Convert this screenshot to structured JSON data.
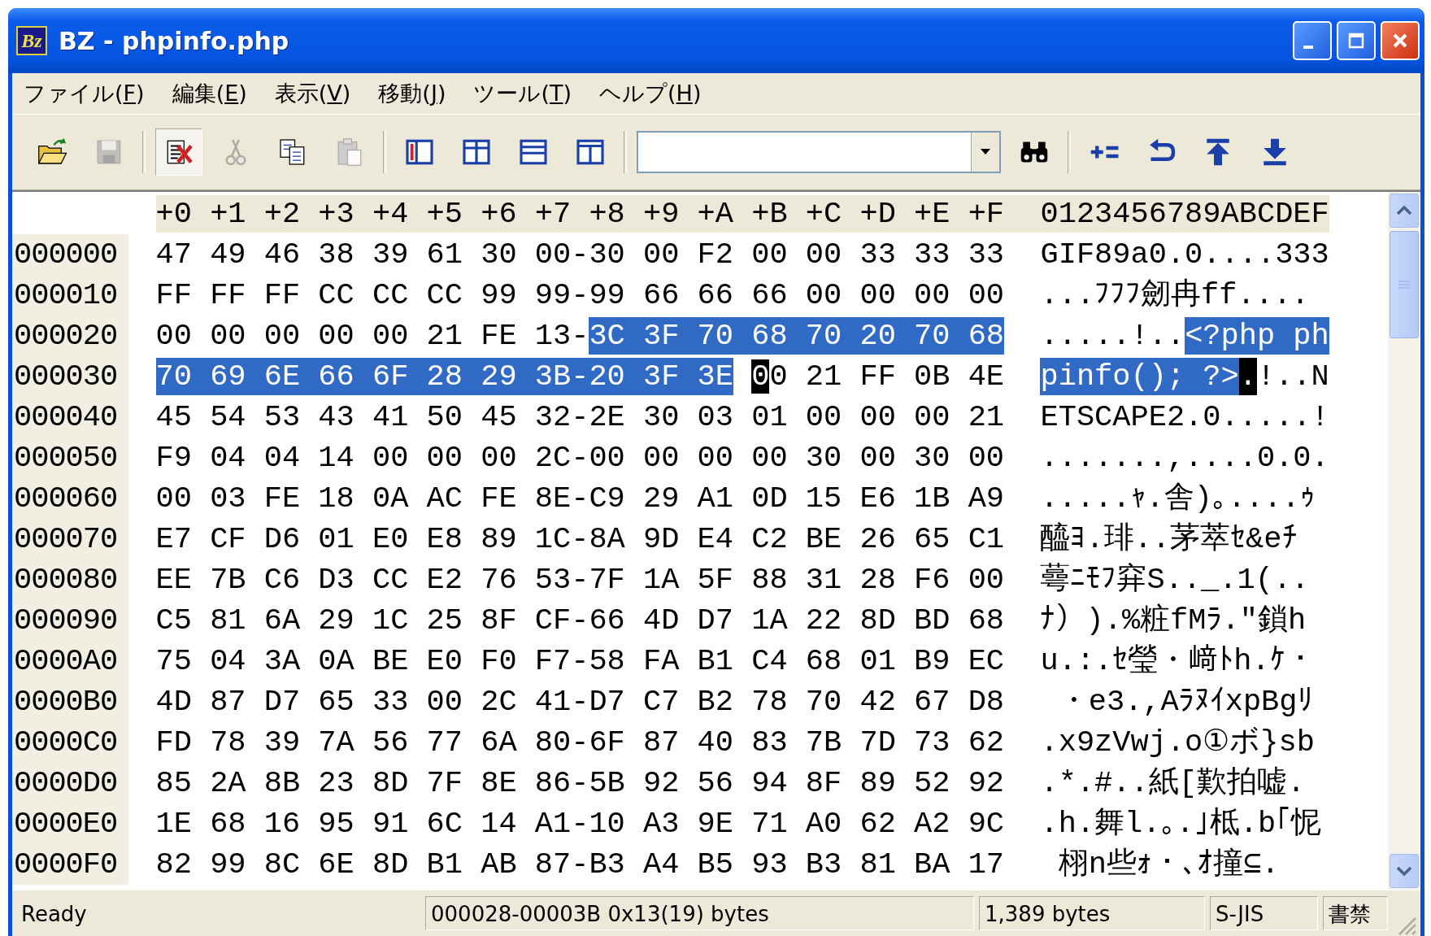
{
  "window": {
    "title": "BZ - phpinfo.php",
    "app_icon_text": "Bz"
  },
  "menu": [
    {
      "before": "ファイル(",
      "accel": "F",
      "after": ")"
    },
    {
      "before": "編集(",
      "accel": "E",
      "after": ")"
    },
    {
      "before": "表示(",
      "accel": "V",
      "after": ")"
    },
    {
      "before": "移動(",
      "accel": "J",
      "after": ")"
    },
    {
      "before": "ツール(",
      "accel": "T",
      "after": ")"
    },
    {
      "before": "ヘルプ(",
      "accel": "H",
      "after": ")"
    }
  ],
  "toolbar": [
    {
      "kind": "open",
      "disabled": false,
      "checked": false
    },
    {
      "kind": "save",
      "disabled": true,
      "checked": false
    },
    {
      "kind": "separator"
    },
    {
      "kind": "edit",
      "disabled": false,
      "checked": true
    },
    {
      "kind": "cut",
      "disabled": true,
      "checked": false
    },
    {
      "kind": "copy",
      "disabled": false,
      "checked": false
    },
    {
      "kind": "paste",
      "disabled": true,
      "checked": false
    },
    {
      "kind": "separator"
    },
    {
      "kind": "view-a",
      "disabled": false,
      "checked": false
    },
    {
      "kind": "view-b",
      "disabled": false,
      "checked": false
    },
    {
      "kind": "view-c",
      "disabled": false,
      "checked": false
    },
    {
      "kind": "view-d",
      "disabled": false,
      "checked": false
    },
    {
      "kind": "separator"
    },
    {
      "kind": "combo"
    },
    {
      "kind": "find",
      "disabled": false,
      "checked": false
    },
    {
      "kind": "separator"
    },
    {
      "kind": "calc",
      "disabled": false,
      "checked": false
    },
    {
      "kind": "back",
      "disabled": false,
      "checked": false
    },
    {
      "kind": "top",
      "disabled": false,
      "checked": false
    },
    {
      "kind": "bottom",
      "disabled": false,
      "checked": false
    }
  ],
  "hex": {
    "columns": [
      "+0",
      "+1",
      "+2",
      "+3",
      "+4",
      "+5",
      "+6",
      "+7",
      "+8",
      "+9",
      "+A",
      "+B",
      "+C",
      "+D",
      "+E",
      "+F"
    ],
    "ascii_header": "0123456789ABCDEF",
    "rows": [
      {
        "address": "000000",
        "separator": "-",
        "bytes": [
          {
            "value": "47",
            "kind": "plain"
          },
          {
            "value": "49",
            "kind": "plain"
          },
          {
            "value": "46",
            "kind": "plain"
          },
          {
            "value": "38",
            "kind": "plain"
          },
          {
            "value": "39",
            "kind": "plain"
          },
          {
            "value": "61",
            "kind": "plain"
          },
          {
            "value": "30",
            "kind": "plain"
          },
          {
            "value": "00",
            "kind": "plain"
          },
          {
            "value": "30",
            "kind": "plain"
          },
          {
            "value": "00",
            "kind": "plain"
          },
          {
            "value": "F2",
            "kind": "plain"
          },
          {
            "value": "00",
            "kind": "plain"
          },
          {
            "value": "00",
            "kind": "plain"
          },
          {
            "value": "33",
            "kind": "plain"
          },
          {
            "value": "33",
            "kind": "plain"
          },
          {
            "value": "33",
            "kind": "plain"
          }
        ],
        "ascii": [
          {
            "text": "GIF89a0.0....333",
            "kind": "plain"
          }
        ]
      },
      {
        "address": "000010",
        "separator": "-",
        "bytes": [
          {
            "value": "FF",
            "kind": "plain"
          },
          {
            "value": "FF",
            "kind": "plain"
          },
          {
            "value": "FF",
            "kind": "plain"
          },
          {
            "value": "CC",
            "kind": "plain"
          },
          {
            "value": "CC",
            "kind": "plain"
          },
          {
            "value": "CC",
            "kind": "plain"
          },
          {
            "value": "99",
            "kind": "plain"
          },
          {
            "value": "99",
            "kind": "plain"
          },
          {
            "value": "99",
            "kind": "plain"
          },
          {
            "value": "66",
            "kind": "plain"
          },
          {
            "value": "66",
            "kind": "plain"
          },
          {
            "value": "66",
            "kind": "plain"
          },
          {
            "value": "00",
            "kind": "plain"
          },
          {
            "value": "00",
            "kind": "plain"
          },
          {
            "value": "00",
            "kind": "plain"
          },
          {
            "value": "00",
            "kind": "plain"
          }
        ],
        "ascii": [
          {
            "text": "...ﾌﾌﾌ劒冉ff....",
            "kind": "plain"
          }
        ]
      },
      {
        "address": "000020",
        "separator": "-",
        "bytes": [
          {
            "value": "00",
            "kind": "plain"
          },
          {
            "value": "00",
            "kind": "plain"
          },
          {
            "value": "00",
            "kind": "plain"
          },
          {
            "value": "00",
            "kind": "plain"
          },
          {
            "value": "00",
            "kind": "plain"
          },
          {
            "value": "21",
            "kind": "plain"
          },
          {
            "value": "FE",
            "kind": "plain"
          },
          {
            "value": "13",
            "kind": "plain"
          },
          {
            "value": "3C",
            "kind": "selected"
          },
          {
            "value": "3F",
            "kind": "selected"
          },
          {
            "value": "70",
            "kind": "selected"
          },
          {
            "value": "68",
            "kind": "selected"
          },
          {
            "value": "70",
            "kind": "selected"
          },
          {
            "value": "20",
            "kind": "selected"
          },
          {
            "value": "70",
            "kind": "selected"
          },
          {
            "value": "68",
            "kind": "selected"
          }
        ],
        "ascii": [
          {
            "text": ".....!..",
            "kind": "plain"
          },
          {
            "text": "<?php ph",
            "kind": "selected"
          }
        ]
      },
      {
        "address": "000030",
        "separator": "-",
        "bytes": [
          {
            "value": "70",
            "kind": "selected"
          },
          {
            "value": "69",
            "kind": "selected"
          },
          {
            "value": "6E",
            "kind": "selected"
          },
          {
            "value": "66",
            "kind": "selected"
          },
          {
            "value": "6F",
            "kind": "selected"
          },
          {
            "value": "28",
            "kind": "selected"
          },
          {
            "value": "29",
            "kind": "selected"
          },
          {
            "value": "3B",
            "kind": "selected"
          },
          {
            "value": "20",
            "kind": "selected"
          },
          {
            "value": "3F",
            "kind": "selected"
          },
          {
            "value": "3E",
            "kind": "selected"
          },
          {
            "value": "00",
            "kind": "cursor"
          },
          {
            "value": "21",
            "kind": "plain"
          },
          {
            "value": "FF",
            "kind": "plain"
          },
          {
            "value": "0B",
            "kind": "plain"
          },
          {
            "value": "4E",
            "kind": "plain"
          }
        ],
        "ascii": [
          {
            "text": "pinfo(); ?>",
            "kind": "selected"
          },
          {
            "text": ".",
            "kind": "cursor"
          },
          {
            "text": "!..N",
            "kind": "plain"
          }
        ]
      },
      {
        "address": "000040",
        "separator": "-",
        "bytes": [
          {
            "value": "45",
            "kind": "plain"
          },
          {
            "value": "54",
            "kind": "plain"
          },
          {
            "value": "53",
            "kind": "plain"
          },
          {
            "value": "43",
            "kind": "plain"
          },
          {
            "value": "41",
            "kind": "plain"
          },
          {
            "value": "50",
            "kind": "plain"
          },
          {
            "value": "45",
            "kind": "plain"
          },
          {
            "value": "32",
            "kind": "plain"
          },
          {
            "value": "2E",
            "kind": "plain"
          },
          {
            "value": "30",
            "kind": "plain"
          },
          {
            "value": "03",
            "kind": "plain"
          },
          {
            "value": "01",
            "kind": "plain"
          },
          {
            "value": "00",
            "kind": "plain"
          },
          {
            "value": "00",
            "kind": "plain"
          },
          {
            "value": "00",
            "kind": "plain"
          },
          {
            "value": "21",
            "kind": "plain"
          }
        ],
        "ascii": [
          {
            "text": "ETSCAPE2.0.....!",
            "kind": "plain"
          }
        ]
      },
      {
        "address": "000050",
        "separator": "-",
        "bytes": [
          {
            "value": "F9",
            "kind": "plain"
          },
          {
            "value": "04",
            "kind": "plain"
          },
          {
            "value": "04",
            "kind": "plain"
          },
          {
            "value": "14",
            "kind": "plain"
          },
          {
            "value": "00",
            "kind": "plain"
          },
          {
            "value": "00",
            "kind": "plain"
          },
          {
            "value": "00",
            "kind": "plain"
          },
          {
            "value": "2C",
            "kind": "plain"
          },
          {
            "value": "00",
            "kind": "plain"
          },
          {
            "value": "00",
            "kind": "plain"
          },
          {
            "value": "00",
            "kind": "plain"
          },
          {
            "value": "00",
            "kind": "plain"
          },
          {
            "value": "30",
            "kind": "plain"
          },
          {
            "value": "00",
            "kind": "plain"
          },
          {
            "value": "30",
            "kind": "plain"
          },
          {
            "value": "00",
            "kind": "plain"
          }
        ],
        "ascii": [
          {
            "text": ".......,....0.0.",
            "kind": "plain"
          }
        ]
      },
      {
        "address": "000060",
        "separator": "-",
        "bytes": [
          {
            "value": "00",
            "kind": "plain"
          },
          {
            "value": "03",
            "kind": "plain"
          },
          {
            "value": "FE",
            "kind": "plain"
          },
          {
            "value": "18",
            "kind": "plain"
          },
          {
            "value": "0A",
            "kind": "plain"
          },
          {
            "value": "AC",
            "kind": "plain"
          },
          {
            "value": "FE",
            "kind": "plain"
          },
          {
            "value": "8E",
            "kind": "plain"
          },
          {
            "value": "C9",
            "kind": "plain"
          },
          {
            "value": "29",
            "kind": "plain"
          },
          {
            "value": "A1",
            "kind": "plain"
          },
          {
            "value": "0D",
            "kind": "plain"
          },
          {
            "value": "15",
            "kind": "plain"
          },
          {
            "value": "E6",
            "kind": "plain"
          },
          {
            "value": "1B",
            "kind": "plain"
          },
          {
            "value": "A9",
            "kind": "plain"
          }
        ],
        "ascii": [
          {
            "text": ".....ｬ.舎)｡....ｩ",
            "kind": "plain"
          }
        ]
      },
      {
        "address": "000070",
        "separator": "-",
        "bytes": [
          {
            "value": "E7",
            "kind": "plain"
          },
          {
            "value": "CF",
            "kind": "plain"
          },
          {
            "value": "D6",
            "kind": "plain"
          },
          {
            "value": "01",
            "kind": "plain"
          },
          {
            "value": "E0",
            "kind": "plain"
          },
          {
            "value": "E8",
            "kind": "plain"
          },
          {
            "value": "89",
            "kind": "plain"
          },
          {
            "value": "1C",
            "kind": "plain"
          },
          {
            "value": "8A",
            "kind": "plain"
          },
          {
            "value": "9D",
            "kind": "plain"
          },
          {
            "value": "E4",
            "kind": "plain"
          },
          {
            "value": "C2",
            "kind": "plain"
          },
          {
            "value": "BE",
            "kind": "plain"
          },
          {
            "value": "26",
            "kind": "plain"
          },
          {
            "value": "65",
            "kind": "plain"
          },
          {
            "value": "C1",
            "kind": "plain"
          }
        ],
        "ascii": [
          {
            "text": "醯ﾖ.琲..茅萃ｾ&eﾁ",
            "kind": "plain"
          }
        ]
      },
      {
        "address": "000080",
        "separator": "-",
        "bytes": [
          {
            "value": "EE",
            "kind": "plain"
          },
          {
            "value": "7B",
            "kind": "plain"
          },
          {
            "value": "C6",
            "kind": "plain"
          },
          {
            "value": "D3",
            "kind": "plain"
          },
          {
            "value": "CC",
            "kind": "plain"
          },
          {
            "value": "E2",
            "kind": "plain"
          },
          {
            "value": "76",
            "kind": "plain"
          },
          {
            "value": "53",
            "kind": "plain"
          },
          {
            "value": "7F",
            "kind": "plain"
          },
          {
            "value": "1A",
            "kind": "plain"
          },
          {
            "value": "5F",
            "kind": "plain"
          },
          {
            "value": "88",
            "kind": "plain"
          },
          {
            "value": "31",
            "kind": "plain"
          },
          {
            "value": "28",
            "kind": "plain"
          },
          {
            "value": "F6",
            "kind": "plain"
          },
          {
            "value": "00",
            "kind": "plain"
          }
        ],
        "ascii": [
          {
            "text": "蕚ﾆﾓﾌ穽S.._.1(..",
            "kind": "plain"
          }
        ]
      },
      {
        "address": "000090",
        "separator": "-",
        "bytes": [
          {
            "value": "C5",
            "kind": "plain"
          },
          {
            "value": "81",
            "kind": "plain"
          },
          {
            "value": "6A",
            "kind": "plain"
          },
          {
            "value": "29",
            "kind": "plain"
          },
          {
            "value": "1C",
            "kind": "plain"
          },
          {
            "value": "25",
            "kind": "plain"
          },
          {
            "value": "8F",
            "kind": "plain"
          },
          {
            "value": "CF",
            "kind": "plain"
          },
          {
            "value": "66",
            "kind": "plain"
          },
          {
            "value": "4D",
            "kind": "plain"
          },
          {
            "value": "D7",
            "kind": "plain"
          },
          {
            "value": "1A",
            "kind": "plain"
          },
          {
            "value": "22",
            "kind": "plain"
          },
          {
            "value": "8D",
            "kind": "plain"
          },
          {
            "value": "BD",
            "kind": "plain"
          },
          {
            "value": "68",
            "kind": "plain"
          }
        ],
        "ascii": [
          {
            "text": "ﾅ）).%粧fMﾗ.\"鎖h",
            "kind": "plain"
          }
        ]
      },
      {
        "address": "0000A0",
        "separator": "-",
        "bytes": [
          {
            "value": "75",
            "kind": "plain"
          },
          {
            "value": "04",
            "kind": "plain"
          },
          {
            "value": "3A",
            "kind": "plain"
          },
          {
            "value": "0A",
            "kind": "plain"
          },
          {
            "value": "BE",
            "kind": "plain"
          },
          {
            "value": "E0",
            "kind": "plain"
          },
          {
            "value": "F0",
            "kind": "plain"
          },
          {
            "value": "F7",
            "kind": "plain"
          },
          {
            "value": "58",
            "kind": "plain"
          },
          {
            "value": "FA",
            "kind": "plain"
          },
          {
            "value": "B1",
            "kind": "plain"
          },
          {
            "value": "C4",
            "kind": "plain"
          },
          {
            "value": "68",
            "kind": "plain"
          },
          {
            "value": "01",
            "kind": "plain"
          },
          {
            "value": "B9",
            "kind": "plain"
          },
          {
            "value": "EC",
            "kind": "plain"
          }
        ],
        "ascii": [
          {
            "text": "u.:.ｾ瑩・﨑ﾄh.ｹ・",
            "kind": "plain"
          }
        ]
      },
      {
        "address": "0000B0",
        "separator": "-",
        "bytes": [
          {
            "value": "4D",
            "kind": "plain"
          },
          {
            "value": "87",
            "kind": "plain"
          },
          {
            "value": "D7",
            "kind": "plain"
          },
          {
            "value": "65",
            "kind": "plain"
          },
          {
            "value": "33",
            "kind": "plain"
          },
          {
            "value": "00",
            "kind": "plain"
          },
          {
            "value": "2C",
            "kind": "plain"
          },
          {
            "value": "41",
            "kind": "plain"
          },
          {
            "value": "D7",
            "kind": "plain"
          },
          {
            "value": "C7",
            "kind": "plain"
          },
          {
            "value": "B2",
            "kind": "plain"
          },
          {
            "value": "78",
            "kind": "plain"
          },
          {
            "value": "70",
            "kind": "plain"
          },
          {
            "value": "42",
            "kind": "plain"
          },
          {
            "value": "67",
            "kind": "plain"
          },
          {
            "value": "D8",
            "kind": "plain"
          }
        ],
        "ascii": [
          {
            "text": " ・e3.,AﾗﾇｲxpBgﾘ",
            "kind": "plain"
          }
        ]
      },
      {
        "address": "0000C0",
        "separator": "-",
        "bytes": [
          {
            "value": "FD",
            "kind": "plain"
          },
          {
            "value": "78",
            "kind": "plain"
          },
          {
            "value": "39",
            "kind": "plain"
          },
          {
            "value": "7A",
            "kind": "plain"
          },
          {
            "value": "56",
            "kind": "plain"
          },
          {
            "value": "77",
            "kind": "plain"
          },
          {
            "value": "6A",
            "kind": "plain"
          },
          {
            "value": "80",
            "kind": "plain"
          },
          {
            "value": "6F",
            "kind": "plain"
          },
          {
            "value": "87",
            "kind": "plain"
          },
          {
            "value": "40",
            "kind": "plain"
          },
          {
            "value": "83",
            "kind": "plain"
          },
          {
            "value": "7B",
            "kind": "plain"
          },
          {
            "value": "7D",
            "kind": "plain"
          },
          {
            "value": "73",
            "kind": "plain"
          },
          {
            "value": "62",
            "kind": "plain"
          }
        ],
        "ascii": [
          {
            "text": ".x9zVwj.o①ボ}sb",
            "kind": "plain"
          }
        ]
      },
      {
        "address": "0000D0",
        "separator": "-",
        "bytes": [
          {
            "value": "85",
            "kind": "plain"
          },
          {
            "value": "2A",
            "kind": "plain"
          },
          {
            "value": "8B",
            "kind": "plain"
          },
          {
            "value": "23",
            "kind": "plain"
          },
          {
            "value": "8D",
            "kind": "plain"
          },
          {
            "value": "7F",
            "kind": "plain"
          },
          {
            "value": "8E",
            "kind": "plain"
          },
          {
            "value": "86",
            "kind": "plain"
          },
          {
            "value": "5B",
            "kind": "plain"
          },
          {
            "value": "92",
            "kind": "plain"
          },
          {
            "value": "56",
            "kind": "plain"
          },
          {
            "value": "94",
            "kind": "plain"
          },
          {
            "value": "8F",
            "kind": "plain"
          },
          {
            "value": "89",
            "kind": "plain"
          },
          {
            "value": "52",
            "kind": "plain"
          },
          {
            "value": "92",
            "kind": "plain"
          }
        ],
        "ascii": [
          {
            "text": ".*.#..紙[歎拍嘘.",
            "kind": "plain"
          }
        ]
      },
      {
        "address": "0000E0",
        "separator": "-",
        "bytes": [
          {
            "value": "1E",
            "kind": "plain"
          },
          {
            "value": "68",
            "kind": "plain"
          },
          {
            "value": "16",
            "kind": "plain"
          },
          {
            "value": "95",
            "kind": "plain"
          },
          {
            "value": "91",
            "kind": "plain"
          },
          {
            "value": "6C",
            "kind": "plain"
          },
          {
            "value": "14",
            "kind": "plain"
          },
          {
            "value": "A1",
            "kind": "plain"
          },
          {
            "value": "10",
            "kind": "plain"
          },
          {
            "value": "A3",
            "kind": "plain"
          },
          {
            "value": "9E",
            "kind": "plain"
          },
          {
            "value": "71",
            "kind": "plain"
          },
          {
            "value": "A0",
            "kind": "plain"
          },
          {
            "value": "62",
            "kind": "plain"
          },
          {
            "value": "A2",
            "kind": "plain"
          },
          {
            "value": "9C",
            "kind": "plain"
          }
        ],
        "ascii": [
          {
            "text": ".h.舞l.｡.｣柢.b｢怩",
            "kind": "plain"
          }
        ]
      },
      {
        "address": "0000F0",
        "separator": "-",
        "bytes": [
          {
            "value": "82",
            "kind": "plain"
          },
          {
            "value": "99",
            "kind": "plain"
          },
          {
            "value": "8C",
            "kind": "plain"
          },
          {
            "value": "6E",
            "kind": "plain"
          },
          {
            "value": "8D",
            "kind": "plain"
          },
          {
            "value": "B1",
            "kind": "plain"
          },
          {
            "value": "AB",
            "kind": "plain"
          },
          {
            "value": "87",
            "kind": "plain"
          },
          {
            "value": "B3",
            "kind": "plain"
          },
          {
            "value": "A4",
            "kind": "plain"
          },
          {
            "value": "B5",
            "kind": "plain"
          },
          {
            "value": "93",
            "kind": "plain"
          },
          {
            "value": "B3",
            "kind": "plain"
          },
          {
            "value": "81",
            "kind": "plain"
          },
          {
            "value": "BA",
            "kind": "plain"
          },
          {
            "value": "17",
            "kind": "plain"
          }
        ],
        "ascii": [
          {
            "text": " 栩n些ｫ・､ｵ撞⊆.",
            "kind": "plain"
          }
        ]
      }
    ]
  },
  "status_bar": [
    "Ready",
    "000028-00003B 0x13(19) bytes",
    "1,389 bytes",
    "S-JIS",
    "書禁"
  ]
}
